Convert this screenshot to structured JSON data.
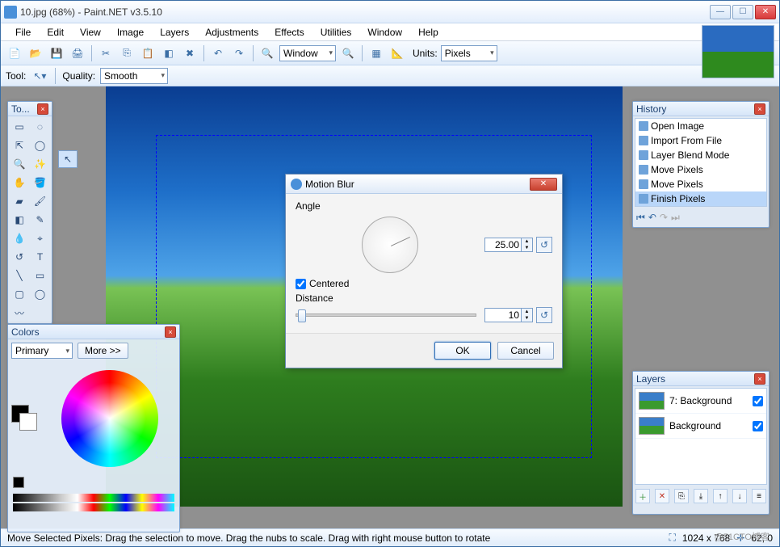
{
  "title": "10.jpg (68%) - Paint.NET v3.5.10",
  "menu": [
    "File",
    "Edit",
    "View",
    "Image",
    "Layers",
    "Adjustments",
    "Effects",
    "Utilities",
    "Window",
    "Help"
  ],
  "toolbar": {
    "zoom_mode": "Window",
    "units_label": "Units:",
    "units_value": "Pixels"
  },
  "toolbar2": {
    "tool_label": "Tool:",
    "quality_label": "Quality:",
    "quality_value": "Smooth"
  },
  "tools_panel_title": "To...",
  "colors": {
    "title": "Colors",
    "primary": "Primary",
    "more": "More >>"
  },
  "history": {
    "title": "History",
    "items": [
      "Open Image",
      "Import From File",
      "Layer Blend Mode",
      "Move Pixels",
      "Move Pixels",
      "Finish Pixels"
    ]
  },
  "layers": {
    "title": "Layers",
    "items": [
      "7: Background",
      "Background"
    ]
  },
  "dialog": {
    "title": "Motion Blur",
    "angle_label": "Angle",
    "angle_value": "25.00",
    "centered": "Centered",
    "distance_label": "Distance",
    "distance_value": "10",
    "ok": "OK",
    "cancel": "Cancel"
  },
  "status": {
    "hint": "Move Selected Pixels: Drag the selection to move. Drag the nubs to scale. Drag with right mouse button to rotate",
    "dims": "1024 x 768",
    "pos": "62, 0"
  },
  "watermark": "@51CTO博客"
}
